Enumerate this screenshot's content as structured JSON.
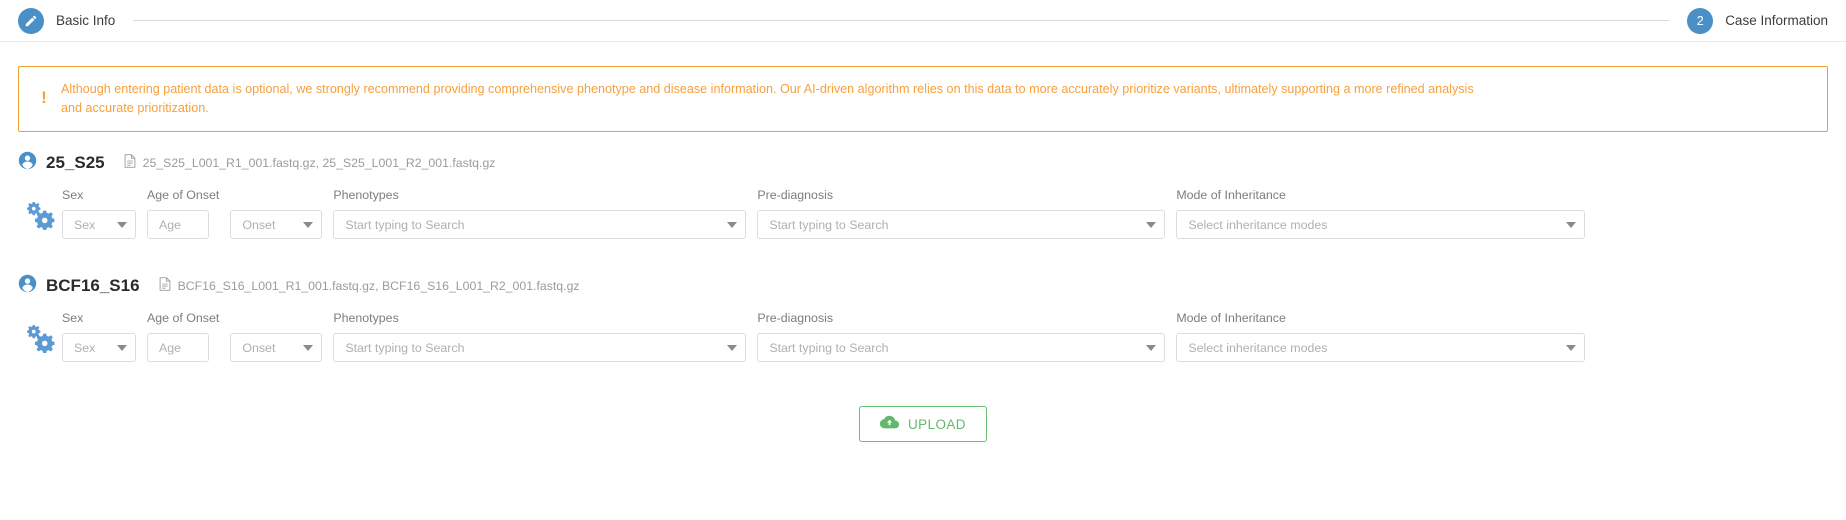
{
  "stepper": {
    "step1": {
      "label": "Basic Info",
      "icon": "pencil-icon",
      "state": "completed"
    },
    "step2": {
      "number": "2",
      "label": "Case Information",
      "state": "active"
    },
    "accent_color": "#4a90c7"
  },
  "alert": {
    "icon": "exclamation-icon",
    "color": "#f5a03c",
    "text": "Although entering patient data is optional, we strongly recommend providing comprehensive phenotype and disease information. Our AI-driven algorithm relies on this data to more accurately prioritize variants, ultimately supporting a more refined analysis and accurate prioritization."
  },
  "field_labels": {
    "sex": "Sex",
    "age_of_onset": "Age of Onset",
    "phenotypes": "Phenotypes",
    "pre_diagnosis": "Pre-diagnosis",
    "mode_of_inheritance": "Mode of Inheritance"
  },
  "placeholders": {
    "sex": "Sex",
    "age": "Age",
    "onset": "Onset",
    "phenotypes": "Start typing to Search",
    "pre_diagnosis": "Start typing to Search",
    "mode_of_inheritance": "Select inheritance modes"
  },
  "samples": [
    {
      "name": "25_S25",
      "files": "25_S25_L001_R1_001.fastq.gz, 25_S25_L001_R2_001.fastq.gz",
      "values": {
        "sex": "",
        "age": "",
        "onset": "",
        "phenotypes": "",
        "pre_diagnosis": "",
        "mode_of_inheritance": ""
      }
    },
    {
      "name": "BCF16_S16",
      "files": "BCF16_S16_L001_R1_001.fastq.gz, BCF16_S16_L001_R2_001.fastq.gz",
      "values": {
        "sex": "",
        "age": "",
        "onset": "",
        "phenotypes": "",
        "pre_diagnosis": "",
        "mode_of_inheritance": ""
      }
    }
  ],
  "upload": {
    "label": "UPLOAD",
    "icon": "cloud-upload-icon",
    "color": "#62b96b"
  }
}
